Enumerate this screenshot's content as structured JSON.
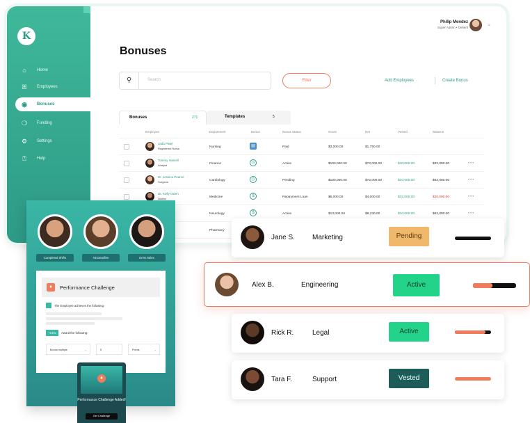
{
  "app": {
    "title": "Bonuses",
    "user": {
      "name": "Philip Mendez",
      "role": "Super Admin • Deltent"
    },
    "sidebar": {
      "items": [
        {
          "label": "Home",
          "icon": "home-icon",
          "glyph": "⌂"
        },
        {
          "label": "Employees",
          "icon": "users-icon",
          "glyph": "ꕤ"
        },
        {
          "label": "Bonuses",
          "icon": "bonus-icon",
          "glyph": "◉"
        },
        {
          "label": "Funding",
          "icon": "funding-icon",
          "glyph": "❍"
        },
        {
          "label": "Settings",
          "icon": "gear-icon",
          "glyph": "⚙"
        },
        {
          "label": "Help",
          "icon": "help-icon",
          "glyph": "⍰"
        }
      ]
    },
    "search_placeholder": "Search",
    "filter_label": "Filter",
    "add_employees": "Add Employees",
    "create_bonus": "Create Bonus",
    "tabs": [
      {
        "label": "Bonuses",
        "count": "271"
      },
      {
        "label": "Templates",
        "count": "5"
      }
    ],
    "columns": [
      "Employee",
      "Department",
      "Bonus",
      "Bonus Status",
      "Gross",
      "Net",
      "Vested",
      "Balance"
    ],
    "rows": [
      {
        "name": "Jada Patel",
        "title": "Registered Nurse",
        "department": "Nursing",
        "bonus_icon": "document-icon",
        "status": "Paid",
        "gross": "$3,000.00",
        "net": "$1,750.00",
        "vested": "",
        "balance": ""
      },
      {
        "name": "Tommy Vassell",
        "title": "Analyst",
        "department": "Finance",
        "bonus_icon": "clock-icon",
        "status": "Active",
        "gross": "$100,000.00",
        "net": "$72,000.00",
        "vested": "$40,000.00",
        "balance": "$32,000.00"
      },
      {
        "name": "Dr. Jessica Pearce",
        "title": "Surgeon",
        "department": "Cardiology",
        "bonus_icon": "clock-icon",
        "status": "Pending",
        "gross": "$100,000.00",
        "net": "$72,000.00",
        "vested": "$10,000.00",
        "balance": "$62,000.00"
      },
      {
        "name": "Dr. Kelly Owen",
        "title": "Doctor",
        "department": "Medicine",
        "bonus_icon": "dollar-icon",
        "status": "Repayment Loan",
        "gross": "$5,000.00",
        "net": "$4,000.00",
        "vested": "$32,000.00",
        "balance": "$20,000.00"
      },
      {
        "name": "",
        "title": "",
        "department": "Neurology",
        "bonus_icon": "dollar-icon",
        "status": "Active",
        "gross": "$13,000.00",
        "net": "$9,230.00",
        "vested": "$10,000.00",
        "balance": "$62,000.00"
      },
      {
        "name": "",
        "title": "",
        "department": "Pharmacy",
        "bonus_icon": "",
        "status": "",
        "gross": "",
        "net": "",
        "vested": "",
        "balance": ""
      }
    ]
  },
  "challenge": {
    "avatar_labels": [
      "Completed Shifts",
      "Hit Deadline",
      "Drew Sales"
    ],
    "title": "Performance Challenge",
    "line1": "The Employee achieves the following:",
    "tag": "THEN",
    "line2": "Award the following:",
    "select1": "Bonus multiple",
    "select2": "5",
    "select3": "Points",
    "toast_text": "Performance Challenge Added!",
    "toast_button": "Get Challenge"
  },
  "cards": [
    {
      "name": "Jane S.",
      "department": "Marketing",
      "status": "Pending",
      "status_color": "#f0b86a",
      "progress": 1.0,
      "bar_color": "#111111",
      "highlighted": false
    },
    {
      "name": "Alex B.",
      "department": "Engineering",
      "status": "Active",
      "status_color": "#23d38a",
      "progress": 0.45,
      "bar_color": "#f07c5d",
      "highlighted": true
    },
    {
      "name": "Rick R.",
      "department": "Legal",
      "status": "Active",
      "status_color": "#23d38a",
      "progress": 0.85,
      "bar_color": "#f07c5d",
      "highlighted": false
    },
    {
      "name": "Tara F.",
      "department": "Support",
      "status": "Vested",
      "status_color": "#1e5c5a",
      "progress": 1.0,
      "bar_color": "#f07c5d",
      "highlighted": false
    }
  ],
  "colors": {
    "brand": "#2d9a86",
    "accent": "#f07c5d",
    "pending": "#f0b86a",
    "active": "#23d38a",
    "vested": "#1e5c5a"
  }
}
